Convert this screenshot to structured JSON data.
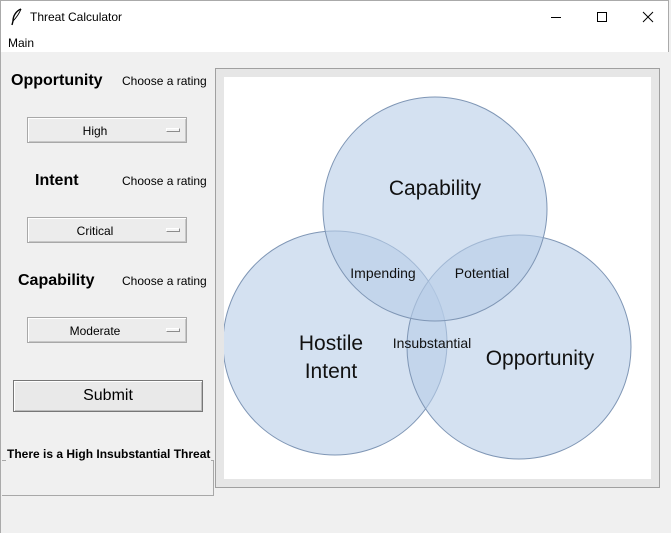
{
  "window": {
    "title": "Threat Calculator",
    "icon": "feather-icon",
    "controls": [
      "minimize-icon",
      "maximize-icon",
      "close-icon"
    ]
  },
  "menu": {
    "items": [
      "Main"
    ]
  },
  "form": {
    "opportunity": {
      "label": "Opportunity",
      "hint": "Choose a rating",
      "selected": "High"
    },
    "intent": {
      "label": "Intent",
      "hint": "Choose a rating",
      "selected": "Critical"
    },
    "capability": {
      "label": "Capability",
      "hint": "Choose a rating",
      "selected": "Moderate"
    },
    "submit_label": "Submit",
    "result_text": "There is a High Insubstantial Threat"
  },
  "venn": {
    "circle_fill": "#b8cde8",
    "circle_stroke": "#7f96b5",
    "labels": {
      "capability": "Capability",
      "hostile": "Hostile",
      "intent": "Intent",
      "opportunity": "Opportunity",
      "impending": "Impending",
      "potential": "Potential",
      "insubstantial": "Insubstantial"
    }
  }
}
